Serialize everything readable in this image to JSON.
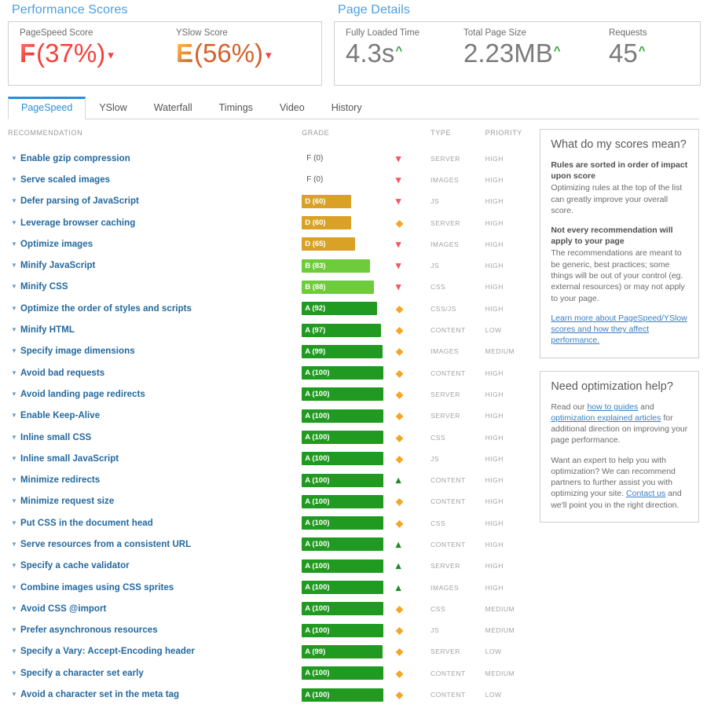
{
  "scores_section": {
    "title": "Performance Scores",
    "metrics": [
      {
        "label": "PageSpeed Score",
        "letter": "F",
        "value": "(37%)",
        "trend": "down",
        "color": "#f4413c"
      },
      {
        "label": "YSlow Score",
        "letter": "E",
        "value": "(56%)",
        "trend": "down",
        "color": "#d2622a"
      }
    ]
  },
  "details_section": {
    "title": "Page Details",
    "metrics": [
      {
        "label": "Fully Loaded Time",
        "value": "4.3s",
        "trend": "up"
      },
      {
        "label": "Total Page Size",
        "value": "2.23MB",
        "trend": "up"
      },
      {
        "label": "Requests",
        "value": "45",
        "trend": "up"
      }
    ]
  },
  "tabs": [
    {
      "label": "PageSpeed",
      "active": true
    },
    {
      "label": "YSlow",
      "active": false
    },
    {
      "label": "Waterfall",
      "active": false
    },
    {
      "label": "Timings",
      "active": false
    },
    {
      "label": "Video",
      "active": false
    },
    {
      "label": "History",
      "active": false
    }
  ],
  "table": {
    "columns": [
      "RECOMMENDATION",
      "GRADE",
      "TYPE",
      "PRIORITY"
    ],
    "rows": [
      {
        "name": "Enable gzip compression",
        "grade": "F (0)",
        "score": 0,
        "trend": "down",
        "type": "SERVER",
        "priority": "HIGH"
      },
      {
        "name": "Serve scaled images",
        "grade": "F (0)",
        "score": 0,
        "trend": "down",
        "type": "IMAGES",
        "priority": "HIGH"
      },
      {
        "name": "Defer parsing of JavaScript",
        "grade": "D (60)",
        "score": 60,
        "trend": "down",
        "type": "JS",
        "priority": "HIGH"
      },
      {
        "name": "Leverage browser caching",
        "grade": "D (60)",
        "score": 60,
        "trend": "flat",
        "type": "SERVER",
        "priority": "HIGH"
      },
      {
        "name": "Optimize images",
        "grade": "D (65)",
        "score": 65,
        "trend": "down",
        "type": "IMAGES",
        "priority": "HIGH"
      },
      {
        "name": "Minify JavaScript",
        "grade": "B (83)",
        "score": 83,
        "trend": "down",
        "type": "JS",
        "priority": "HIGH"
      },
      {
        "name": "Minify CSS",
        "grade": "B (88)",
        "score": 88,
        "trend": "down",
        "type": "CSS",
        "priority": "HIGH"
      },
      {
        "name": "Optimize the order of styles and scripts",
        "grade": "A (92)",
        "score": 92,
        "trend": "flat",
        "type": "CSS/JS",
        "priority": "HIGH"
      },
      {
        "name": "Minify HTML",
        "grade": "A (97)",
        "score": 97,
        "trend": "flat",
        "type": "CONTENT",
        "priority": "LOW"
      },
      {
        "name": "Specify image dimensions",
        "grade": "A (99)",
        "score": 99,
        "trend": "flat",
        "type": "IMAGES",
        "priority": "MEDIUM"
      },
      {
        "name": "Avoid bad requests",
        "grade": "A (100)",
        "score": 100,
        "trend": "flat",
        "type": "CONTENT",
        "priority": "HIGH"
      },
      {
        "name": "Avoid landing page redirects",
        "grade": "A (100)",
        "score": 100,
        "trend": "flat",
        "type": "SERVER",
        "priority": "HIGH"
      },
      {
        "name": "Enable Keep-Alive",
        "grade": "A (100)",
        "score": 100,
        "trend": "flat",
        "type": "SERVER",
        "priority": "HIGH"
      },
      {
        "name": "Inline small CSS",
        "grade": "A (100)",
        "score": 100,
        "trend": "flat",
        "type": "CSS",
        "priority": "HIGH"
      },
      {
        "name": "Inline small JavaScript",
        "grade": "A (100)",
        "score": 100,
        "trend": "flat",
        "type": "JS",
        "priority": "HIGH"
      },
      {
        "name": "Minimize redirects",
        "grade": "A (100)",
        "score": 100,
        "trend": "up",
        "type": "CONTENT",
        "priority": "HIGH"
      },
      {
        "name": "Minimize request size",
        "grade": "A (100)",
        "score": 100,
        "trend": "flat",
        "type": "CONTENT",
        "priority": "HIGH"
      },
      {
        "name": "Put CSS in the document head",
        "grade": "A (100)",
        "score": 100,
        "trend": "flat",
        "type": "CSS",
        "priority": "HIGH"
      },
      {
        "name": "Serve resources from a consistent URL",
        "grade": "A (100)",
        "score": 100,
        "trend": "up",
        "type": "CONTENT",
        "priority": "HIGH"
      },
      {
        "name": "Specify a cache validator",
        "grade": "A (100)",
        "score": 100,
        "trend": "up",
        "type": "SERVER",
        "priority": "HIGH"
      },
      {
        "name": "Combine images using CSS sprites",
        "grade": "A (100)",
        "score": 100,
        "trend": "up",
        "type": "IMAGES",
        "priority": "HIGH"
      },
      {
        "name": "Avoid CSS @import",
        "grade": "A (100)",
        "score": 100,
        "trend": "flat",
        "type": "CSS",
        "priority": "MEDIUM"
      },
      {
        "name": "Prefer asynchronous resources",
        "grade": "A (100)",
        "score": 100,
        "trend": "flat",
        "type": "JS",
        "priority": "MEDIUM"
      },
      {
        "name": "Specify a Vary: Accept-Encoding header",
        "grade": "A (99)",
        "score": 99,
        "trend": "flat",
        "type": "SERVER",
        "priority": "LOW"
      },
      {
        "name": "Specify a character set early",
        "grade": "A (100)",
        "score": 100,
        "trend": "flat",
        "type": "CONTENT",
        "priority": "MEDIUM"
      },
      {
        "name": "Avoid a character set in the meta tag",
        "grade": "A (100)",
        "score": 100,
        "trend": "flat",
        "type": "CONTENT",
        "priority": "LOW"
      }
    ]
  },
  "sidebar": {
    "scores_panel": {
      "title": "What do my scores mean?",
      "h1": "Rules are sorted in order of impact upon score",
      "p1": "Optimizing rules at the top of the list can greatly improve your overall score.",
      "h2": "Not every recommendation will apply to your page",
      "p2": "The recommendations are meant to be generic, best practices; some things will be out of your control (eg. external resources) or may not apply to your page.",
      "link": "Learn more about PageSpeed/YSlow scores and how they affect performance."
    },
    "help_panel": {
      "title": "Need optimization help?",
      "p1_a": "Read our ",
      "p1_link1": "how to guides",
      "p1_b": " and ",
      "p1_link2": "optimization explained articles",
      "p1_c": " for additional direction on improving your page performance.",
      "p2_a": "Want an expert to help you with optimization? We can recommend partners to further assist you with optimizing your site. ",
      "p2_link": "Contact us",
      "p2_b": " and we'll point you in the right direction."
    }
  },
  "colors": {
    "accent_blue": "#4a9fe0",
    "grade_a": "#219a21",
    "grade_b": "#6ecb3c",
    "grade_d": "#d9a227",
    "trend_down": "#f25963",
    "trend_up": "#1f8a2a",
    "trend_flat": "#f5a623"
  }
}
